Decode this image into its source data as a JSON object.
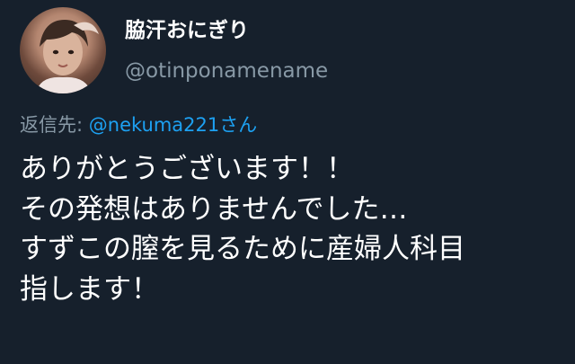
{
  "author": {
    "display_name": "脇汗おにぎり",
    "handle": "@otinponamename"
  },
  "reply": {
    "prefix": "返信先: ",
    "mention": "@nekuma221さん"
  },
  "tweet": {
    "lines": [
      "ありがとうございます！！",
      "その発想はありませんでした…",
      "すずこの膣を見るために産婦人科目",
      "指します！"
    ]
  },
  "colors": {
    "background": "#16202c",
    "text": "#ffffff",
    "secondary": "#8899a6",
    "link": "#1da1f2"
  }
}
